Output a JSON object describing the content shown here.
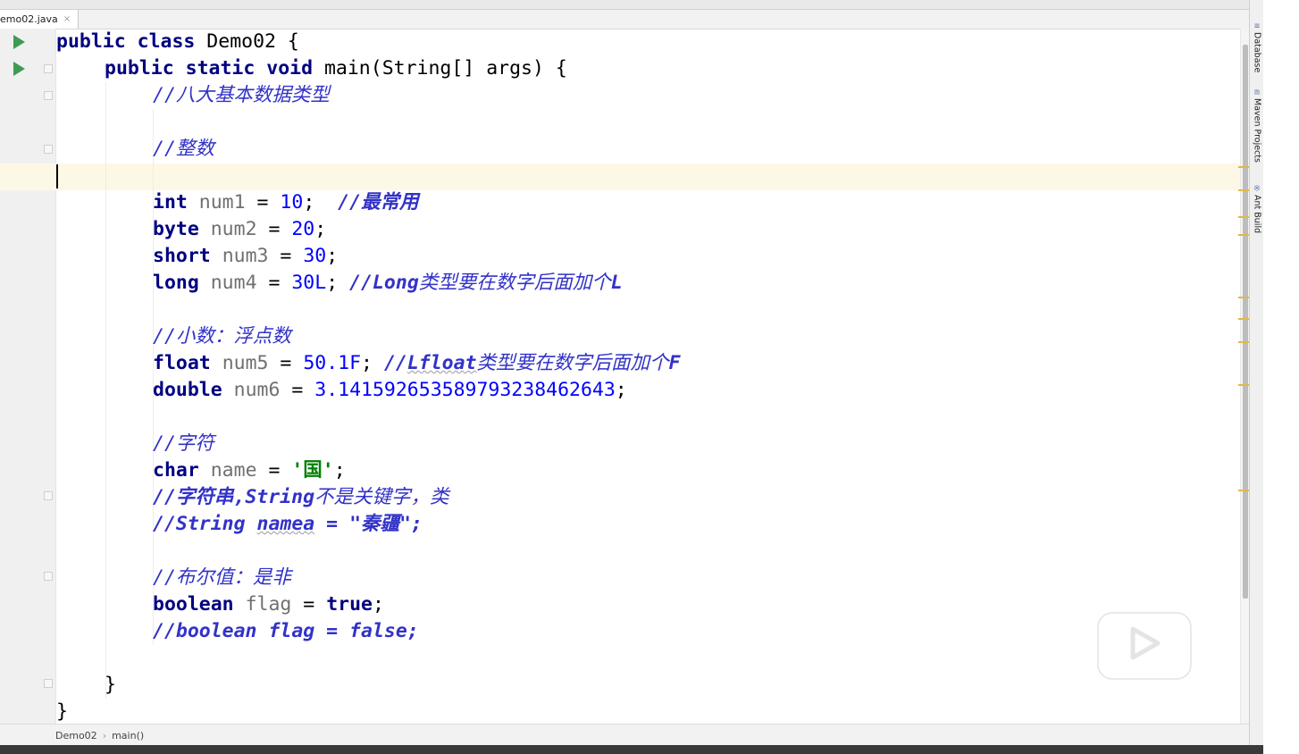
{
  "tab": {
    "file_name": "emo02.java",
    "close_glyph": "×"
  },
  "code_lines": [
    "public class Demo02 {",
    "public static void main(String[] args) {",
    "//八大基本数据类型",
    "//整数",
    "int num1 = 10;  //最常用",
    "byte num2 = 20;",
    "short num3 = 30;",
    "long num4 = 30L; //Long类型要在数字后面加个L",
    "//小数：浮点数",
    "float num5 = 50.1F; //Lfloat类型要在数字后面加个F",
    "double num6 = 3.141592653589793238462643;",
    "//字符",
    "char name = '国';",
    "//字符串,String不是关键字，类",
    "//String namea = \"秦疆\";",
    "//布尔值：是非",
    "boolean flag = true;",
    "//boolean flag = false;",
    "}",
    "}"
  ],
  "tokens": {
    "l1": {
      "k1": "public",
      "k2": "class",
      "t": " Demo02 {"
    },
    "l2": {
      "k1": "public",
      "k2": "static",
      "k3": "void",
      "t": " main(String[] args) {"
    },
    "l3": {
      "c": "//八大基本数据类型"
    },
    "l4": {
      "c": "//整数"
    },
    "l5": {
      "k": "int",
      "v": "num1",
      "eq": " = ",
      "n": "10",
      "semi": ";  ",
      "c": "//最常用"
    },
    "l6": {
      "k": "byte",
      "v": "num2",
      "eq": " = ",
      "n": "20",
      "semi": ";"
    },
    "l7": {
      "k": "short",
      "v": "num3",
      "eq": " = ",
      "n": "30",
      "semi": ";"
    },
    "l8": {
      "k": "long",
      "v": "num4",
      "eq": " = ",
      "n": "30L",
      "semi": "; ",
      "c1": "//Long",
      "c2": "类型要在数字后面加个",
      "c3": "L"
    },
    "l9": {
      "c": "//小数：浮点数"
    },
    "l10": {
      "k": "float",
      "v": "num5",
      "eq": " = ",
      "n": "50.1F",
      "semi": "; ",
      "c1": "//",
      "c2": "Lfloat",
      "c3": "类型要在数字后面加个",
      "c4": "F"
    },
    "l11": {
      "k": "double",
      "v": "num6",
      "eq": " = ",
      "n": "3.141592653589793238462643",
      "semi": ";"
    },
    "l12": {
      "c": "//字符"
    },
    "l13": {
      "k": "char",
      "v": "name",
      "eq": " = ",
      "s": "'国'",
      "semi": ";"
    },
    "l14": {
      "c1": "//字符串,",
      "c2": "String",
      "c3": "不是关键字，类"
    },
    "l15": {
      "c1": "//String ",
      "c2": "namea",
      "c3": " = \"秦疆\";"
    },
    "l16": {
      "c": "//布尔值：是非"
    },
    "l17": {
      "k": "boolean",
      "v": "flag",
      "eq": " = ",
      "k2": "true",
      "semi": ";"
    },
    "l18": {
      "c": "//boolean flag = false;"
    },
    "l19": {
      "t": "}"
    },
    "l20": {
      "t": "}"
    }
  },
  "breadcrumb": {
    "class_name": "Demo02",
    "separator": "›",
    "method": "main()"
  },
  "right_tool_windows": [
    {
      "label": "Database",
      "icon": "database-icon"
    },
    {
      "label": "Maven Projects",
      "icon": "maven-icon"
    },
    {
      "label": "Ant Build",
      "icon": "ant-icon"
    }
  ],
  "colors": {
    "keyword": "#000080",
    "number": "#0000ff",
    "comment": "#3232c8",
    "variable": "#707070",
    "char_literal": "#008000",
    "current_line": "#fdf8e6",
    "run_icon": "#3f9a55"
  }
}
